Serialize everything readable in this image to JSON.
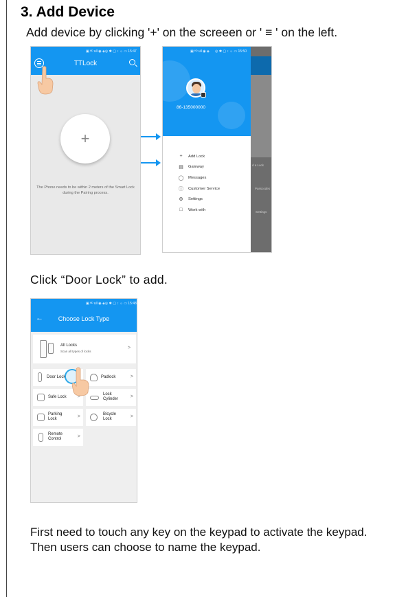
{
  "heading": "3. Add Device",
  "instruction_add": "Add device by clicking '+' on the screeen or ' ≡ '  on the left.",
  "instruction_door_lock": "Click “Door Lock” to add.",
  "instruction_keypad_line1": "First need to touch any key on the keypad to activate the keypad.",
  "instruction_keypad_line2": "Then users can choose to name the keypad.",
  "phone_home": {
    "status_left": "▣ ᴴᴰ ull ◉ ◈",
    "status_right": "◎ ✱ ▢ ↕ ☼ ▭ 15:47",
    "app_title": "TTLock",
    "add_symbol": "+",
    "pairing_note": "The Phone needs to be within 2 meters of the Smart Lock during the Pairing process."
  },
  "phone_drawer": {
    "status_left": "▣ ᴴᴰ ull ◉ ◈",
    "status_right": "◎ ✱ ▢ ↕ ☼ ▭ 15:50",
    "account": "86-135000000",
    "menu": [
      {
        "label": "Add Lock",
        "icon": "+"
      },
      {
        "label": "Gateway",
        "icon": "▤"
      },
      {
        "label": "Messages",
        "icon": "◯"
      },
      {
        "label": "Customer Service",
        "icon": "ⓘ"
      },
      {
        "label": "Settings",
        "icon": "⚙"
      },
      {
        "label": "Work with",
        "icon": "□"
      }
    ],
    "bg_fragments": [
      "d a Lock",
      "Passcodes",
      "Settings"
    ]
  },
  "phone_lock_type": {
    "status_left": "▣ ᴴᴰ ull ◉ ◈",
    "status_right": "◎ ✱ ▢ ↕ ☼ ▭ 15:48",
    "back_symbol": "←",
    "title": "Choose Lock Type",
    "all_locks_title": "All Locks",
    "all_locks_subtitle": "Scan all types of locks",
    "chevron": ">",
    "types": {
      "door_lock": "Door Lock",
      "padlock": "Padlock",
      "safe_lock": "Safe Lock",
      "lock_cylinder": "Lock Cylinder",
      "parking_lock": "Parking Lock",
      "bicycle_lock": "Bicycle Lock",
      "remote_control": "Remote Control"
    }
  }
}
